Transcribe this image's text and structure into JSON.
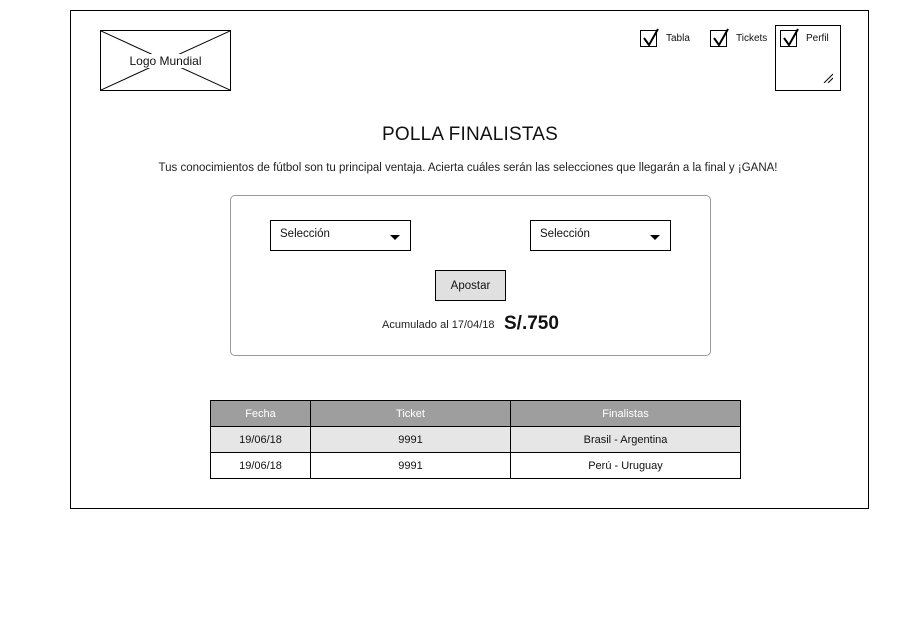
{
  "header": {
    "logo_label": "Logo Mundial",
    "nav": [
      {
        "label": "Tabla",
        "checked": true
      },
      {
        "label": "Tickets",
        "checked": true
      },
      {
        "label": "Perfil",
        "checked": true
      }
    ]
  },
  "main": {
    "title": "POLLA FINALISTAS",
    "subtitle": "Tus conocimientos de fútbol son tu principal ventaja. Acierta cuáles serán las selecciones que llegarán a la final y ¡GANA!",
    "bet": {
      "select_1_value": "Selección",
      "select_2_value": "Selección",
      "button_label": "Apostar",
      "accumulated_label": "Acumulado al 17/04/18",
      "accumulated_amount": "S/.750"
    },
    "table": {
      "columns": [
        "Fecha",
        "Ticket",
        "Finalistas"
      ],
      "rows": [
        [
          "19/06/18",
          "9991",
          "Brasil - Argentina"
        ],
        [
          "19/06/18",
          "9991",
          "Perú - Uruguay"
        ]
      ]
    }
  },
  "colors": {
    "table_header_bg": "#9e9e9e",
    "table_row_alt_bg": "#e6e6e6",
    "button_bg": "#e0e0e0"
  },
  "icons": [
    "image-placeholder-icon",
    "checkmark-icon",
    "resize-handle-icon",
    "chevron-down-icon"
  ]
}
